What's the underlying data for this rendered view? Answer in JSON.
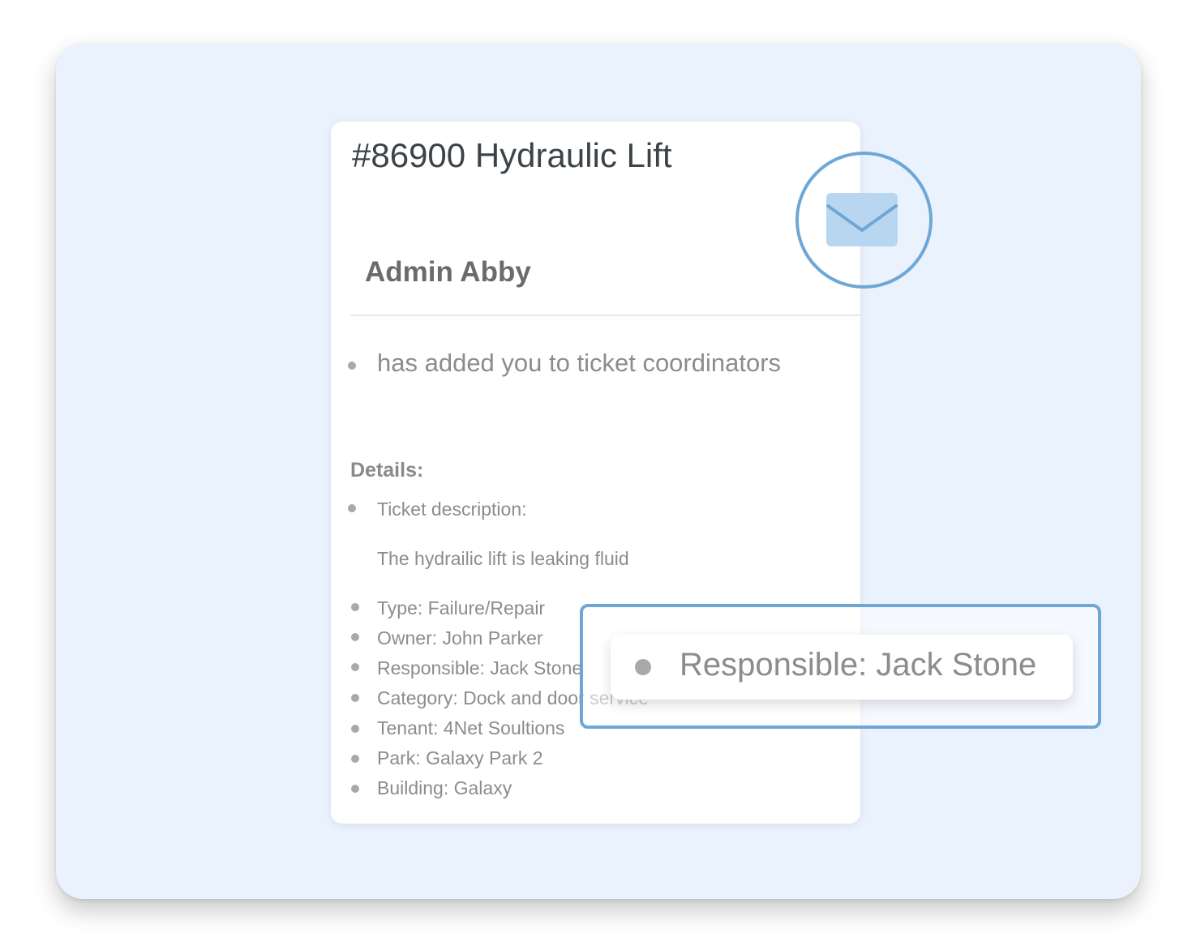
{
  "notification": {
    "ticket_title": "#86900 Hydraulic Lift",
    "sender": "Admin Abby",
    "message": "has added you to ticket coordinators",
    "details_heading": "Details:",
    "ticket_description_label": "Ticket description:",
    "ticket_description": "The hydrailic lift is leaking fluid",
    "items": [
      "Type: Failure/Repair",
      "Owner: John Parker",
      "Responsible: Jack Stone",
      "Category: Dock and door service",
      "Tenant: 4Net Soultions",
      "Park: Galaxy Park 2",
      "Building: Galaxy"
    ]
  },
  "callout": {
    "text": "Responsible: Jack Stone"
  },
  "icons": {
    "mail": "envelope-icon"
  },
  "colors": {
    "accent": "#6ea7d6",
    "panel_background": "#eaf2fe",
    "envelope_fill": "#b9d6f0"
  }
}
